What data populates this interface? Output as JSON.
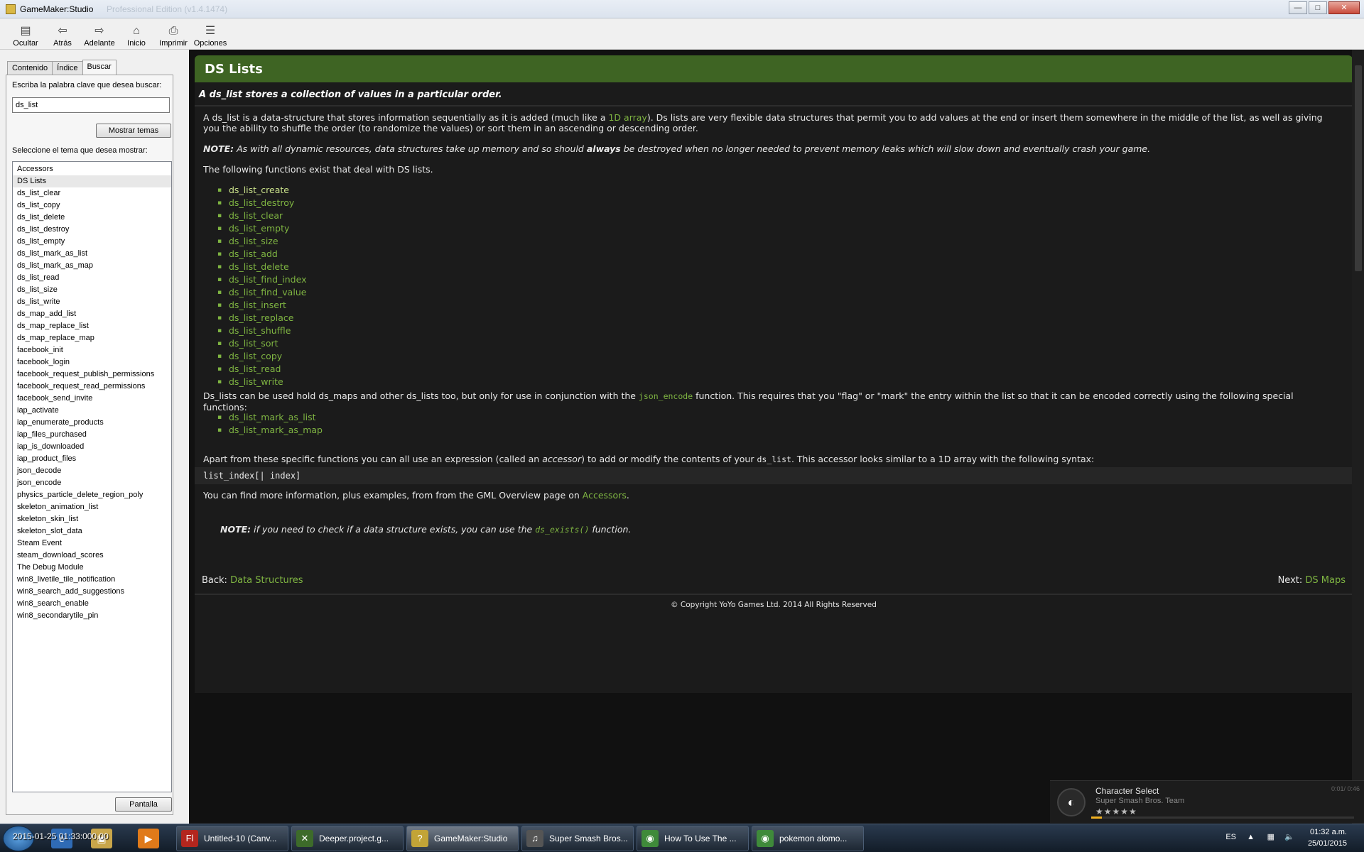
{
  "window": {
    "title": "GameMaker:Studio",
    "ghost_title": "Professional Edition (v1.4.1474)",
    "buttons": {
      "minimize": "—",
      "maximize": "□",
      "close": "✕"
    }
  },
  "toolbar": {
    "items": [
      {
        "label": "Ocultar",
        "icon": "hide-icon"
      },
      {
        "label": "Atrás",
        "icon": "back-arrow-icon"
      },
      {
        "label": "Adelante",
        "icon": "forward-arrow-icon"
      },
      {
        "label": "Inicio",
        "icon": "home-icon"
      },
      {
        "label": "Imprimir",
        "icon": "printer-icon"
      },
      {
        "label": "Opciones",
        "icon": "options-icon"
      }
    ]
  },
  "nav": {
    "tabs": [
      "Contenido",
      "Índice",
      "Buscar"
    ],
    "active_tab": "Buscar",
    "keyword_label": "Escriba la palabra clave que desea buscar:",
    "keyword_value": "ds_list",
    "show_topics_button": "Mostrar temas",
    "topic_label": "Seleccione el tema que desea mostrar:",
    "topics": [
      "Accessors",
      "DS Lists",
      "ds_list_clear",
      "ds_list_copy",
      "ds_list_delete",
      "ds_list_destroy",
      "ds_list_empty",
      "ds_list_mark_as_list",
      "ds_list_mark_as_map",
      "ds_list_read",
      "ds_list_size",
      "ds_list_write",
      "ds_map_add_list",
      "ds_map_replace_list",
      "ds_map_replace_map",
      "facebook_init",
      "facebook_login",
      "facebook_request_publish_permissions",
      "facebook_request_read_permissions",
      "facebook_send_invite",
      "iap_activate",
      "iap_enumerate_products",
      "iap_files_purchased",
      "iap_is_downloaded",
      "iap_product_files",
      "json_decode",
      "json_encode",
      "physics_particle_delete_region_poly",
      "skeleton_animation_list",
      "skeleton_skin_list",
      "skeleton_slot_data",
      "Steam Event",
      "steam_download_scores",
      "The Debug Module",
      "win8_livetile_tile_notification",
      "win8_search_add_suggestions",
      "win8_search_enable",
      "win8_secondarytile_pin"
    ],
    "selected_topic": "DS Lists",
    "display_button": "Pantalla"
  },
  "page": {
    "title": "DS Lists",
    "summary": "A ds_list stores a collection of values in a particular order.",
    "intro_before_link": "A ds_list is a data-structure that stores information sequentially as it is added (much like a ",
    "intro_link": "1D array",
    "intro_after_link": "). Ds lists are very flexible data structures that permit you to add values at the end or insert them somewhere in the middle of the list, as well as giving you the ability to shuffle the order (to randomize the values) or sort them in an ascending or descending order.",
    "note_label": "NOTE:",
    "note_before": " As with all dynamic resources, data structures take up memory and so should ",
    "note_bold": "always",
    "note_after": " be destroyed when no longer needed to prevent memory leaks which will slow down and eventually crash your game.",
    "functions_intro": "The following functions exist that deal with DS lists.",
    "functions": [
      "ds_list_create",
      "ds_list_destroy",
      "ds_list_clear",
      "ds_list_empty",
      "ds_list_size",
      "ds_list_add",
      "ds_list_delete",
      "ds_list_find_index",
      "ds_list_find_value",
      "ds_list_insert",
      "ds_list_replace",
      "ds_list_shuffle",
      "ds_list_sort",
      "ds_list_copy",
      "ds_list_read",
      "ds_list_write"
    ],
    "json_before": "Ds_lists can be used hold ds_maps and other ds_lists too, but only for use in conjunction with the ",
    "json_code": "json_encode",
    "json_after": " function. This requires that you \"flag\" or \"mark\" the entry within the list so that it can be encoded correctly using the following special functions:",
    "mark_functions": [
      "ds_list_mark_as_list",
      "ds_list_mark_as_map"
    ],
    "accessor_before": "Apart from these specific functions you can all use an expression (called an ",
    "accessor_italic": "accessor",
    "accessor_middle": ") to add or modify the contents of your ",
    "accessor_code": "ds_list",
    "accessor_after": ". This accessor looks similar to a 1D array with the following syntax:",
    "code_sample": "list_index[| index]",
    "more_before": "You can find more information, plus examples, from from the GML Overview page on ",
    "more_link": "Accessors",
    "more_after": ".",
    "note2_label": "NOTE:",
    "note2_before": " if you need to check if a data structure exists, you can use the ",
    "note2_code": "ds_exists()",
    "note2_after": " function.",
    "back_label": "Back:",
    "back_link": "Data Structures",
    "next_label": "Next:",
    "next_link": "DS Maps",
    "copyright": "© Copyright YoYo Games Ltd. 2014 All Rights Reserved"
  },
  "media_toast": {
    "title": "Character Select",
    "artist": "Super Smash Bros. Team",
    "rating": "★★★★★",
    "time": "0:01/ 0:46",
    "progress": 0.04
  },
  "taskbar": {
    "overlay_text": "2015-01-25 01:33:000.00",
    "tasks": [
      {
        "label": "Untitled-10 (Canv...",
        "icon": "flash-icon",
        "glyph": "Fl",
        "color": "#b3261e"
      },
      {
        "label": "Deeper.project.g...",
        "icon": "yoyo-icon",
        "glyph": "✕",
        "color": "#3d6b2a"
      },
      {
        "label": "GameMaker:Studio",
        "icon": "help-icon",
        "glyph": "?",
        "color": "#c2a437"
      },
      {
        "label": "Super Smash Bros...",
        "icon": "music-player-icon",
        "glyph": "♫",
        "color": "#555555"
      },
      {
        "label": "How To Use The ...",
        "icon": "chrome-icon",
        "glyph": "◉",
        "color": "#3f8a3a"
      },
      {
        "label": "pokemon alomo...",
        "icon": "chrome-icon",
        "glyph": "◉",
        "color": "#3f8a3a"
      }
    ],
    "active_task": "GameMaker:Studio",
    "tray": {
      "lang": "ES",
      "time": "01:32 a.m.",
      "date": "25/01/2015"
    }
  }
}
